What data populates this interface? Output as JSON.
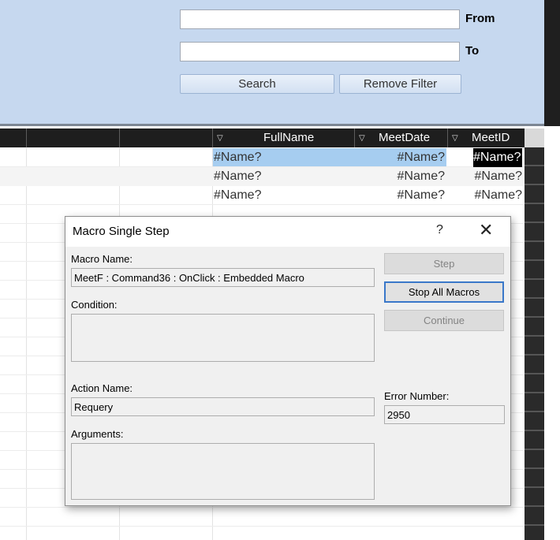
{
  "filter": {
    "from_label": "From",
    "to_label": "To",
    "from_value": "",
    "to_value": "",
    "search_label": "Search",
    "remove_filter_label": "Remove Filter"
  },
  "grid": {
    "columns": [
      {
        "label": "FullName",
        "icon": "sort-arrow-icon"
      },
      {
        "label": "MeetDate",
        "icon": "sort-arrow-icon"
      },
      {
        "label": "MeetID",
        "icon": "sort-arrow-icon"
      }
    ],
    "rows": [
      {
        "fullname": "#Name?",
        "meetdate": "#Name?",
        "meetid": "#Name?"
      },
      {
        "fullname": "#Name?",
        "meetdate": "#Name?",
        "meetid": "#Name?"
      },
      {
        "fullname": "#Name?",
        "meetdate": "#Name?",
        "meetid": "#Name?"
      }
    ],
    "colors": {
      "selected_row": "#a6cdf0",
      "header": "#1e1e1e"
    }
  },
  "dialog": {
    "title": "Macro Single Step",
    "help_glyph": "?",
    "close_glyph": "✕",
    "macro_name_label": "Macro Name:",
    "macro_name": "MeetF : Command36 : OnClick : Embedded Macro",
    "condition_label": "Condition:",
    "condition": "",
    "action_name_label": "Action Name:",
    "action_name": "Requery",
    "arguments_label": "Arguments:",
    "arguments": "",
    "error_number_label": "Error Number:",
    "error_number": "2950",
    "buttons": {
      "step": "Step",
      "stop_all": "Stop All Macros",
      "continue": "Continue"
    }
  }
}
